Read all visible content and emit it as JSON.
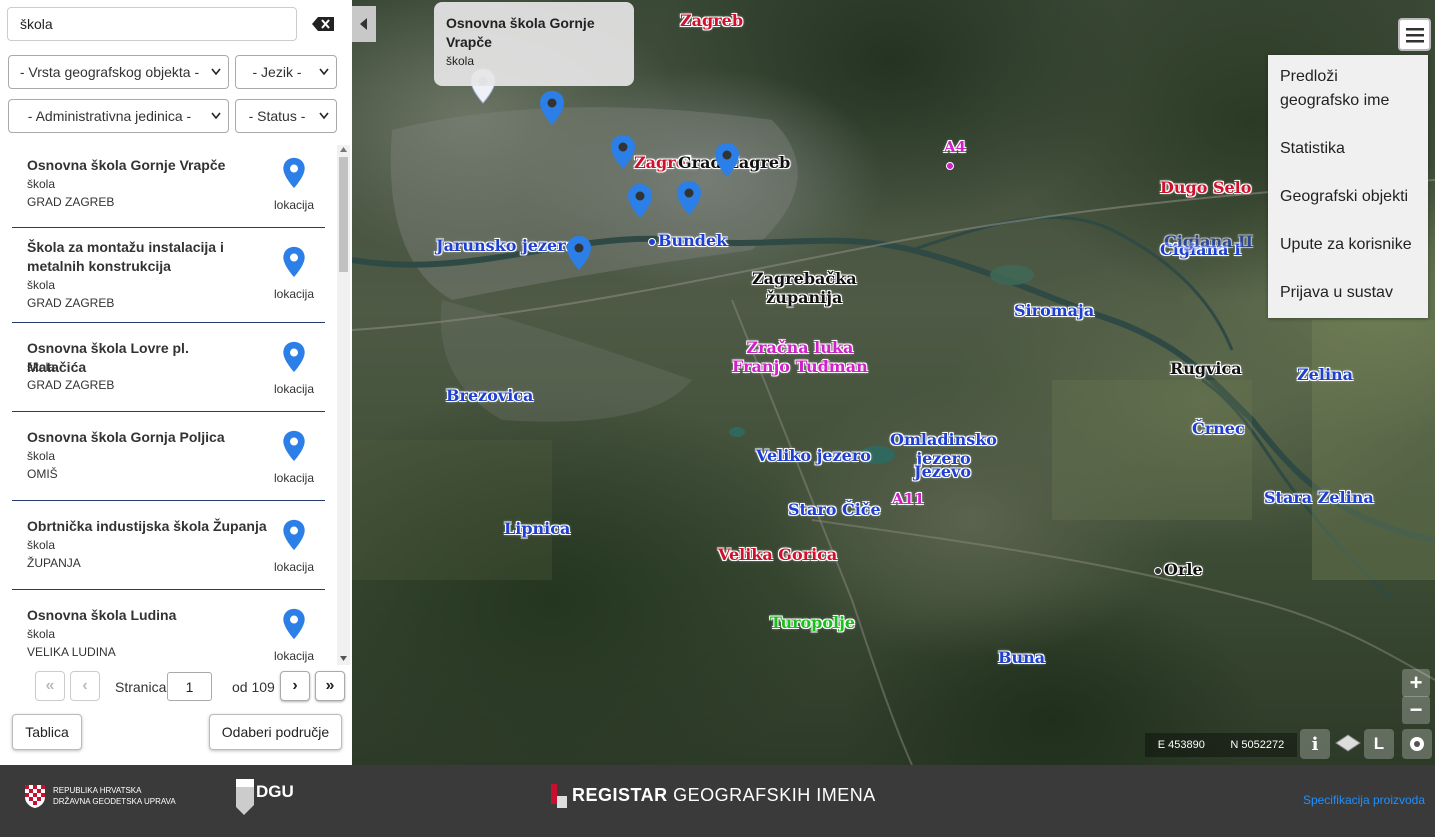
{
  "search": {
    "value": "škola"
  },
  "filters": {
    "type": "- Vrsta geografskog objekta -",
    "language": "- Jezik -",
    "admin_unit": "- Administrativna jedinica -",
    "status": "- Status -"
  },
  "results": [
    {
      "name": "Osnovna škola Gornje Vrapče",
      "type": "škola",
      "place": "GRAD ZAGREB",
      "loc_label": "lokacija"
    },
    {
      "name": "Škola za montažu instalacija i metalnih konstrukcija",
      "type": "škola",
      "place": "GRAD ZAGREB",
      "loc_label": "lokacija"
    },
    {
      "name": "Osnovna škola Lovre pl. Matačića",
      "type": "škola",
      "place": "GRAD ZAGREB",
      "loc_label": "lokacija"
    },
    {
      "name": "Osnovna škola Gornja Poljica",
      "type": "škola",
      "place": "OMIŠ",
      "loc_label": "lokacija"
    },
    {
      "name": "Obrtnička industijska škola Županja",
      "type": "škola",
      "place": "ŽUPANJA",
      "loc_label": "lokacija"
    },
    {
      "name": "Osnovna škola Ludina",
      "type": "škola",
      "place": "VELIKA LUDINA",
      "loc_label": "lokacija"
    }
  ],
  "pagination": {
    "label": "Stranica",
    "current": "1",
    "of": "od 109"
  },
  "buttons": {
    "table": "Tablica",
    "select_area": "Odaberi područje"
  },
  "popup": {
    "title": "Osnovna škola Gornje Vrapče",
    "subtitle": "škola"
  },
  "menu": {
    "items": [
      "Predloži geografsko ime",
      "Statistika",
      "Geografski objekti",
      "Upute za korisnike",
      "Prijava u sustav"
    ]
  },
  "map_labels": [
    {
      "text": "Zagreb",
      "color": "red"
    },
    {
      "text": "Zagreb",
      "color": "red"
    },
    {
      "text": "Grad Zagreb",
      "color": "black"
    },
    {
      "text": "A4",
      "color": "magenta"
    },
    {
      "text": "Dugo Selo",
      "color": "red"
    },
    {
      "text": "Jarunsko jezero",
      "color": "blue"
    },
    {
      "text": "Bundek",
      "color": "blue"
    },
    {
      "text": "Zagrebačka",
      "color": "black"
    },
    {
      "text": "županija",
      "color": "black"
    },
    {
      "text": "Cigiana I",
      "color": "blue"
    },
    {
      "text": "Cigiana II",
      "color": "blue"
    },
    {
      "text": "Siromaja",
      "color": "blue"
    },
    {
      "text": "Zračna luka",
      "color": "magenta"
    },
    {
      "text": "Franjo Tuđman",
      "color": "magenta"
    },
    {
      "text": "Brezovica",
      "color": "blue"
    },
    {
      "text": "Rugvica",
      "color": "black"
    },
    {
      "text": "Zelina",
      "color": "blue"
    },
    {
      "text": "Črnec",
      "color": "blue"
    },
    {
      "text": "Omladinsko",
      "color": "blue"
    },
    {
      "text": "jezero",
      "color": "blue"
    },
    {
      "text": "Jezevo",
      "color": "blue"
    },
    {
      "text": "Veliko jezero",
      "color": "blue"
    },
    {
      "text": "A11",
      "color": "magenta"
    },
    {
      "text": "Staro Čiče",
      "color": "blue"
    },
    {
      "text": "Stara Zelina",
      "color": "blue"
    },
    {
      "text": "Lipnica",
      "color": "blue"
    },
    {
      "text": "Velika Gorica",
      "color": "red"
    },
    {
      "text": "Orle",
      "color": "black"
    },
    {
      "text": "Turopolje",
      "color": "green"
    },
    {
      "text": "Buna",
      "color": "blue"
    }
  ],
  "map_controls": {
    "zoom_in": "+",
    "zoom_out": "−",
    "easting": "E 453890",
    "northing": "N 5052272",
    "info": "i",
    "layer_L": "L"
  },
  "footer": {
    "institution_line1": "REPUBLIKA HRVATSKA",
    "institution_line2": "DRŽAVNA GEODETSKA UPRAVA",
    "dgu": "DGU",
    "registry_bold": "REGISTAR",
    "registry_rest": " GEOGRAFSKIH IMENA",
    "spec_link": "Specifikacija proizvoda"
  },
  "colors": {
    "blue_label": "#1f3fd0",
    "red_label": "#d0102c",
    "magenta_label": "#d020c8",
    "green_label": "#18c01a",
    "pin": "#2b7fe6",
    "footer_bg": "#3a3a3a",
    "link": "#1e90ff"
  }
}
